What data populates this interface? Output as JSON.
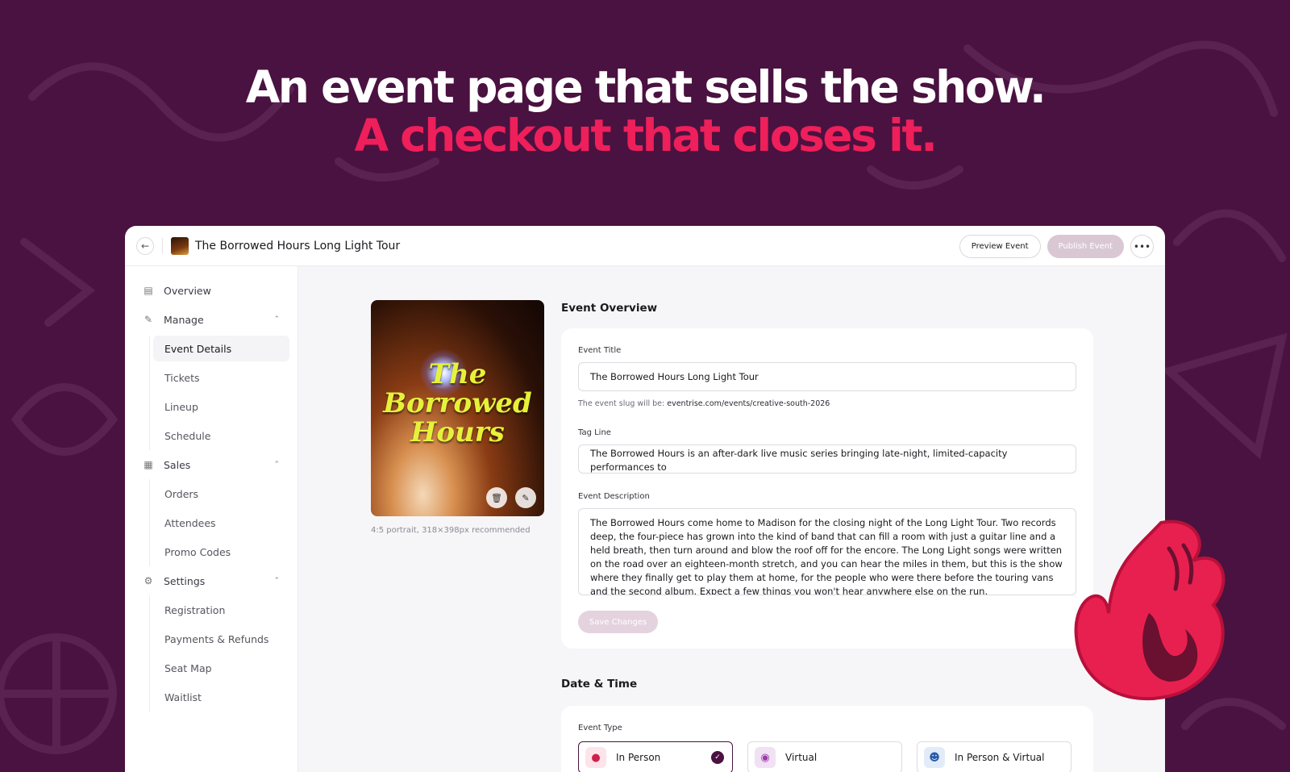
{
  "hero": {
    "line1": "An event page that sells the show.",
    "line2": "A checkout that closes it."
  },
  "colors": {
    "background": "#4a1240",
    "accent": "#ee1f5a",
    "primary": "#4a1240"
  },
  "topbar": {
    "back_icon": "arrow-left-icon",
    "event_name": "The Borrowed Hours Long Light Tour",
    "preview_label": "Preview Event",
    "publish_label": "Publish Event",
    "more_label": "•••"
  },
  "sidebar": {
    "overview": "Overview",
    "manage": {
      "label": "Manage",
      "items": [
        "Event Details",
        "Tickets",
        "Lineup",
        "Schedule"
      ],
      "active": "Event Details"
    },
    "sales": {
      "label": "Sales",
      "items": [
        "Orders",
        "Attendees",
        "Promo Codes"
      ]
    },
    "settings": {
      "label": "Settings",
      "items": [
        "Registration",
        "Payments & Refunds",
        "Seat Map",
        "Waitlist"
      ]
    }
  },
  "poster": {
    "title_line1": "The",
    "title_line2": "Borrowed",
    "title_line3": "Hours",
    "hint": "4:5 portrait, 318×398px recommended"
  },
  "event_overview": {
    "title": "Event Overview",
    "event_title_label": "Event Title",
    "event_title_value": "The Borrowed Hours Long Light Tour",
    "slug_prefix": "The event slug will be: ",
    "slug_value": "eventrise.com/events/creative-south-2026",
    "tagline_label": "Tag Line",
    "tagline_value": "The Borrowed Hours is an after-dark live music series bringing late-night, limited-capacity performances to",
    "description_label": "Event Description",
    "description_value": "The Borrowed Hours come home to Madison for the closing night of the Long Light Tour. Two records deep, the four-piece has grown into the kind of band that can fill a room with just a guitar line and a held breath, then turn around and blow the roof off for the encore. The Long Light songs were written on the road over an eighteen-month stretch, and you can hear the miles in them, but this is the show where they finally get to play them at home, for the people who were there before the touring vans and the second album. Expect a few things you won't hear anywhere else on the run.",
    "save_label": "Save Changes"
  },
  "date_time": {
    "title": "Date & Time",
    "event_type_label": "Event Type",
    "options": [
      "In Person",
      "Virtual",
      "In Person & Virtual"
    ],
    "selected": "In Person"
  }
}
